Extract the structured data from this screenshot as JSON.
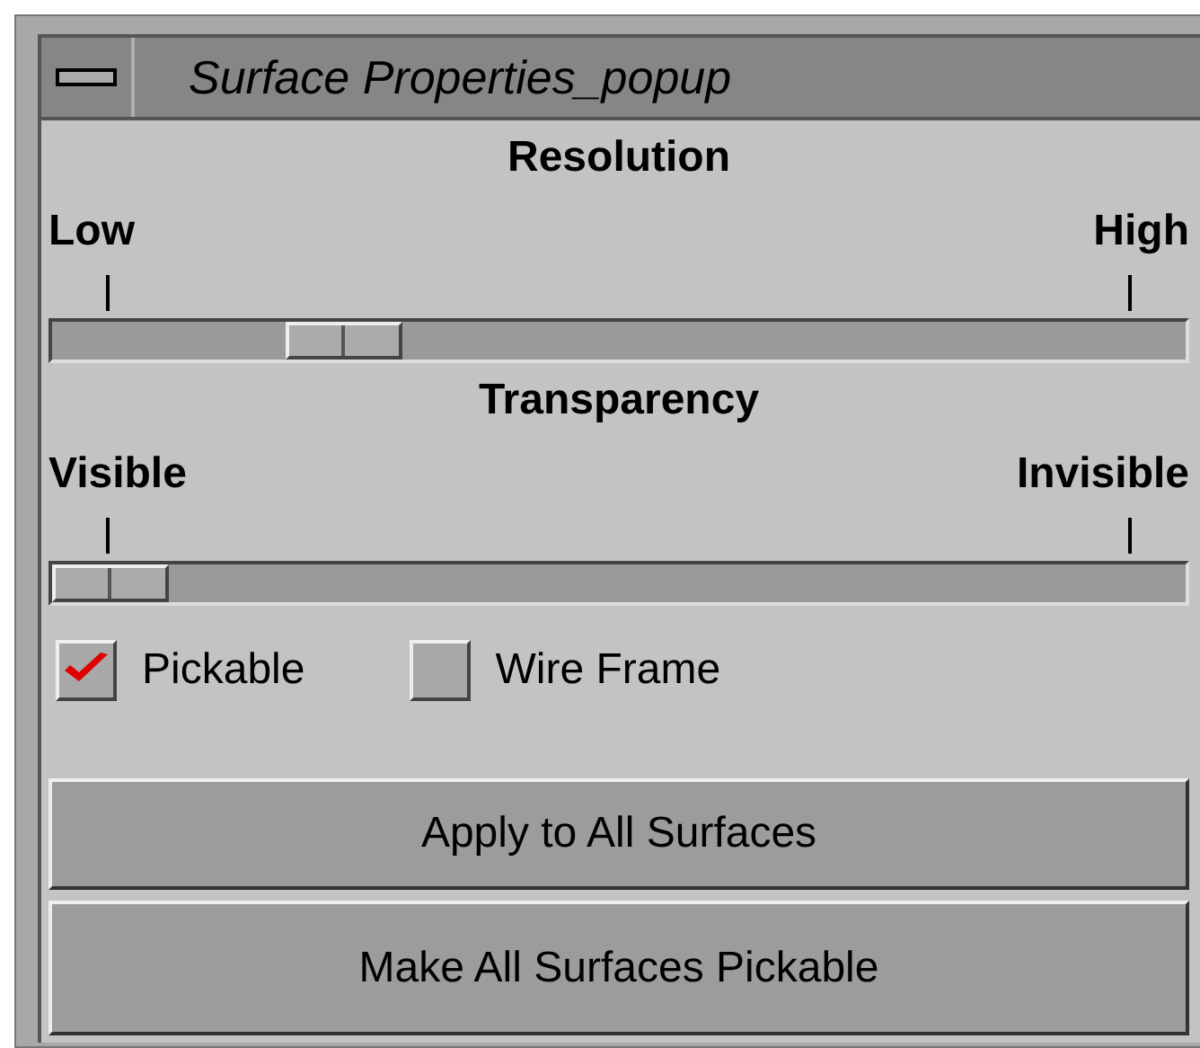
{
  "window": {
    "title": "Surface Properties_popup"
  },
  "sliders": [
    {
      "label": "Resolution",
      "min_label": "Low",
      "max_label": "High",
      "level": 0.23
    },
    {
      "label": "Transparency",
      "min_label": "Visible",
      "max_label": "Invisible",
      "level": 0
    }
  ],
  "checkboxes": [
    {
      "label": "Pickable",
      "checked": true
    },
    {
      "label": "Wire Frame",
      "checked": false
    }
  ],
  "buttons": [
    "Apply to All Surfaces",
    "Make All Surfaces Pickable"
  ]
}
